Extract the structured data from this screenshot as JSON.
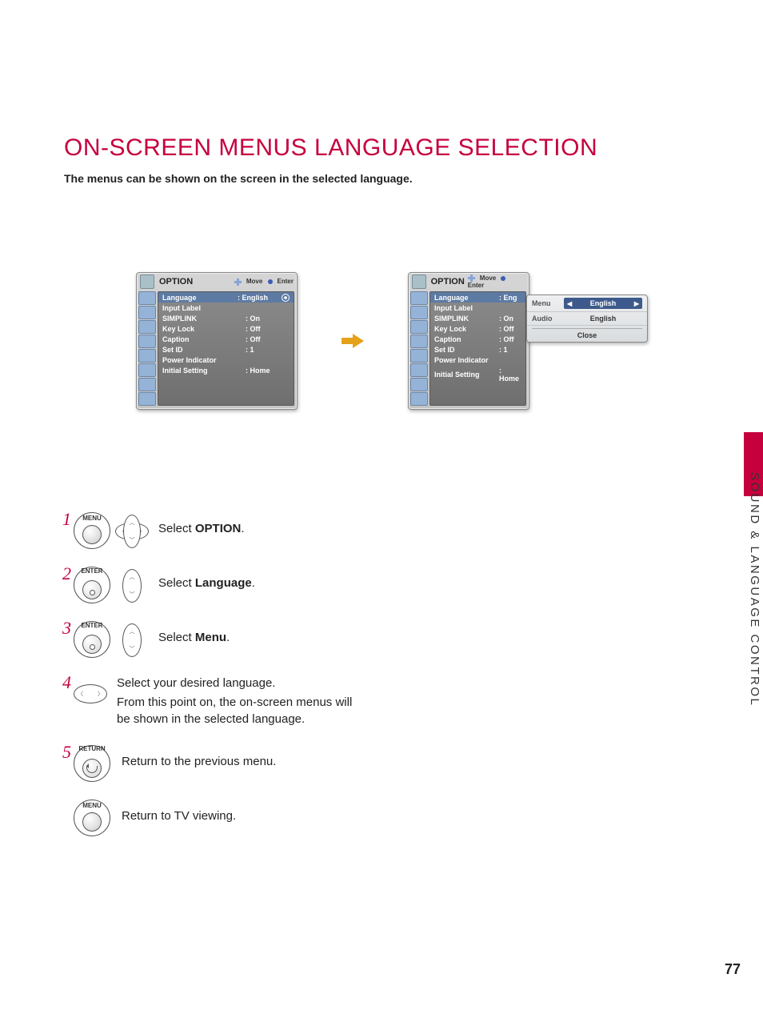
{
  "page": {
    "title": "ON-SCREEN MENUS LANGUAGE SELECTION",
    "intro": "The menus can be shown on the screen in the selected language.",
    "side_label": "SOUND & LANGUAGE CONTROL",
    "page_number": "77"
  },
  "osd_hints": {
    "move": "Move",
    "enter": "Enter"
  },
  "osd1": {
    "title": "OPTION",
    "rows": [
      {
        "label": "Language",
        "value": ": English",
        "active": true,
        "radio": true
      },
      {
        "label": "Input Label",
        "value": ""
      },
      {
        "label": "SIMPLINK",
        "value": ": On"
      },
      {
        "label": "Key Lock",
        "value": ": Off"
      },
      {
        "label": "Caption",
        "value": ": Off"
      },
      {
        "label": "Set ID",
        "value": ": 1"
      },
      {
        "label": "Power Indicator",
        "value": ""
      },
      {
        "label": "Initial Setting",
        "value": ": Home"
      }
    ]
  },
  "osd2": {
    "title": "OPTION",
    "rows": [
      {
        "label": "Language",
        "value": ": Eng",
        "active": true
      },
      {
        "label": "Input Label",
        "value": ""
      },
      {
        "label": "SIMPLINK",
        "value": ": On"
      },
      {
        "label": "Key Lock",
        "value": ": Off"
      },
      {
        "label": "Caption",
        "value": ": Off"
      },
      {
        "label": "Set ID",
        "value": ": 1"
      },
      {
        "label": "Power Indicator",
        "value": ""
      },
      {
        "label": "Initial Setting",
        "value": ": Home"
      }
    ],
    "submenu": {
      "menu_row": {
        "label": "Menu",
        "value": "English"
      },
      "audio_row": {
        "label": "Audio",
        "value": "English"
      },
      "close": "Close"
    }
  },
  "buttons": {
    "menu": "MENU",
    "enter": "ENTER",
    "return": "RETURN"
  },
  "steps": {
    "s1": {
      "num": "1",
      "pre": "Select ",
      "bold": "OPTION",
      "post": "."
    },
    "s2": {
      "num": "2",
      "pre": "Select ",
      "bold": "Language",
      "post": "."
    },
    "s3": {
      "num": "3",
      "pre": "Select ",
      "bold": "Menu",
      "post": "."
    },
    "s4": {
      "num": "4",
      "line1": "Select your desired language.",
      "line2": "From this point on, the on-screen menus will be shown in the selected language."
    },
    "s5": {
      "num": "5",
      "text": "Return to the previous menu."
    },
    "s6": {
      "text": "Return to TV viewing."
    }
  }
}
